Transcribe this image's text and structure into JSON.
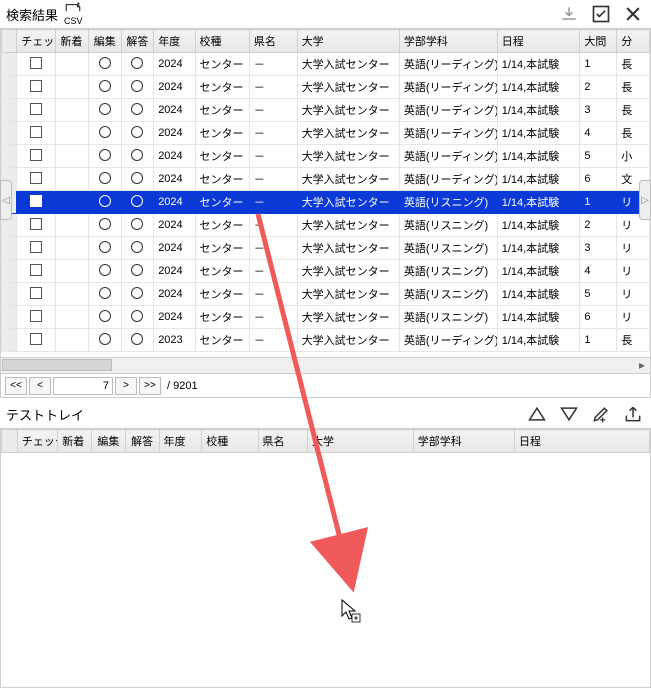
{
  "search_results_label": "検索結果",
  "csv_label": "CSV",
  "pager": {
    "page": "7",
    "total": "/ 9201",
    "first": "<<",
    "prev": "<",
    "next": ">",
    "last": ">>"
  },
  "columns": {
    "check": "チェック",
    "new": "新着",
    "edit": "編集",
    "ans": "解答",
    "year": "年度",
    "school": "校種",
    "pref": "県名",
    "univ": "大学",
    "dept": "学部学科",
    "sched": "日程",
    "q": "大問",
    "field": "分"
  },
  "rows": [
    {
      "year": "2024",
      "school": "センター",
      "pref": "－",
      "univ": "大学入試センター",
      "dept": "英語(リーディング)",
      "sched": "1/14,本試験",
      "q": "1",
      "field": "長"
    },
    {
      "year": "2024",
      "school": "センター",
      "pref": "－",
      "univ": "大学入試センター",
      "dept": "英語(リーディング)",
      "sched": "1/14,本試験",
      "q": "2",
      "field": "長"
    },
    {
      "year": "2024",
      "school": "センター",
      "pref": "－",
      "univ": "大学入試センター",
      "dept": "英語(リーディング)",
      "sched": "1/14,本試験",
      "q": "3",
      "field": "長"
    },
    {
      "year": "2024",
      "school": "センター",
      "pref": "－",
      "univ": "大学入試センター",
      "dept": "英語(リーディング)",
      "sched": "1/14,本試験",
      "q": "4",
      "field": "長"
    },
    {
      "year": "2024",
      "school": "センター",
      "pref": "－",
      "univ": "大学入試センター",
      "dept": "英語(リーディング)",
      "sched": "1/14,本試験",
      "q": "5",
      "field": "小"
    },
    {
      "year": "2024",
      "school": "センター",
      "pref": "－",
      "univ": "大学入試センター",
      "dept": "英語(リーディング)",
      "sched": "1/14,本試験",
      "q": "6",
      "field": "文"
    },
    {
      "year": "2024",
      "school": "センター",
      "pref": "－",
      "univ": "大学入試センター",
      "dept": "英語(リスニング)",
      "sched": "1/14,本試験",
      "q": "1",
      "field": "リ",
      "selected": true
    },
    {
      "year": "2024",
      "school": "センター",
      "pref": "－",
      "univ": "大学入試センター",
      "dept": "英語(リスニング)",
      "sched": "1/14,本試験",
      "q": "2",
      "field": "リ"
    },
    {
      "year": "2024",
      "school": "センター",
      "pref": "－",
      "univ": "大学入試センター",
      "dept": "英語(リスニング)",
      "sched": "1/14,本試験",
      "q": "3",
      "field": "リ"
    },
    {
      "year": "2024",
      "school": "センター",
      "pref": "－",
      "univ": "大学入試センター",
      "dept": "英語(リスニング)",
      "sched": "1/14,本試験",
      "q": "4",
      "field": "リ"
    },
    {
      "year": "2024",
      "school": "センター",
      "pref": "－",
      "univ": "大学入試センター",
      "dept": "英語(リスニング)",
      "sched": "1/14,本試験",
      "q": "5",
      "field": "リ"
    },
    {
      "year": "2024",
      "school": "センター",
      "pref": "－",
      "univ": "大学入試センター",
      "dept": "英語(リスニング)",
      "sched": "1/14,本試験",
      "q": "6",
      "field": "リ"
    },
    {
      "year": "2023",
      "school": "センター",
      "pref": "－",
      "univ": "大学入試センター",
      "dept": "英語(リーディング)",
      "sched": "1/14,本試験",
      "q": "1",
      "field": "長"
    }
  ],
  "tray_label": "テストトレイ",
  "tray_columns": {
    "check": "チェック",
    "new": "新着",
    "edit": "編集",
    "ans": "解答",
    "year": "年度",
    "school": "校種",
    "pref": "県名",
    "univ": "大学",
    "dept": "学部学科",
    "sched": "日程"
  }
}
